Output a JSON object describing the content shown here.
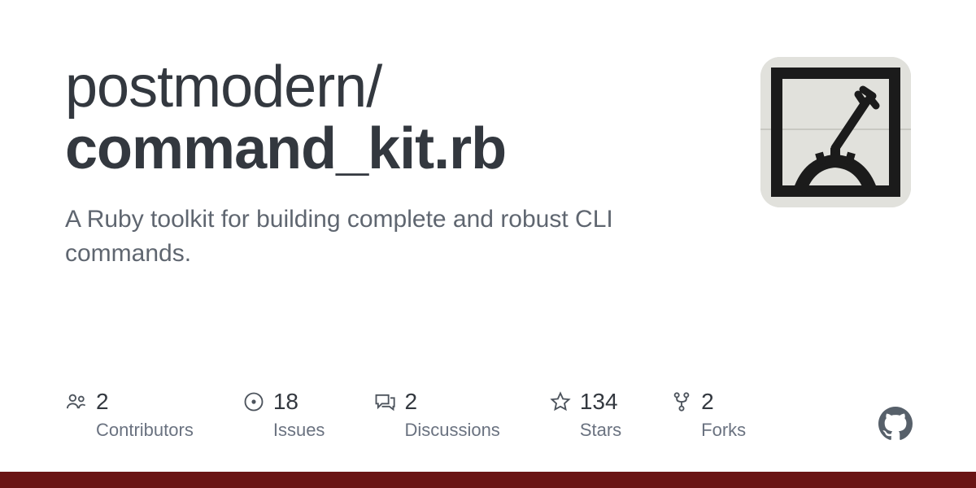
{
  "title": {
    "owner": "postmodern",
    "separator": "/",
    "repo": "command_kit.rb"
  },
  "description": "A Ruby toolkit for building complete and robust CLI commands.",
  "stats": {
    "contributors": {
      "count": "2",
      "label": "Contributors"
    },
    "issues": {
      "count": "18",
      "label": "Issues"
    },
    "discussions": {
      "count": "2",
      "label": "Discussions"
    },
    "stars": {
      "count": "134",
      "label": "Stars"
    },
    "forks": {
      "count": "2",
      "label": "Forks"
    }
  },
  "colors": {
    "accent": "#6a1414"
  }
}
